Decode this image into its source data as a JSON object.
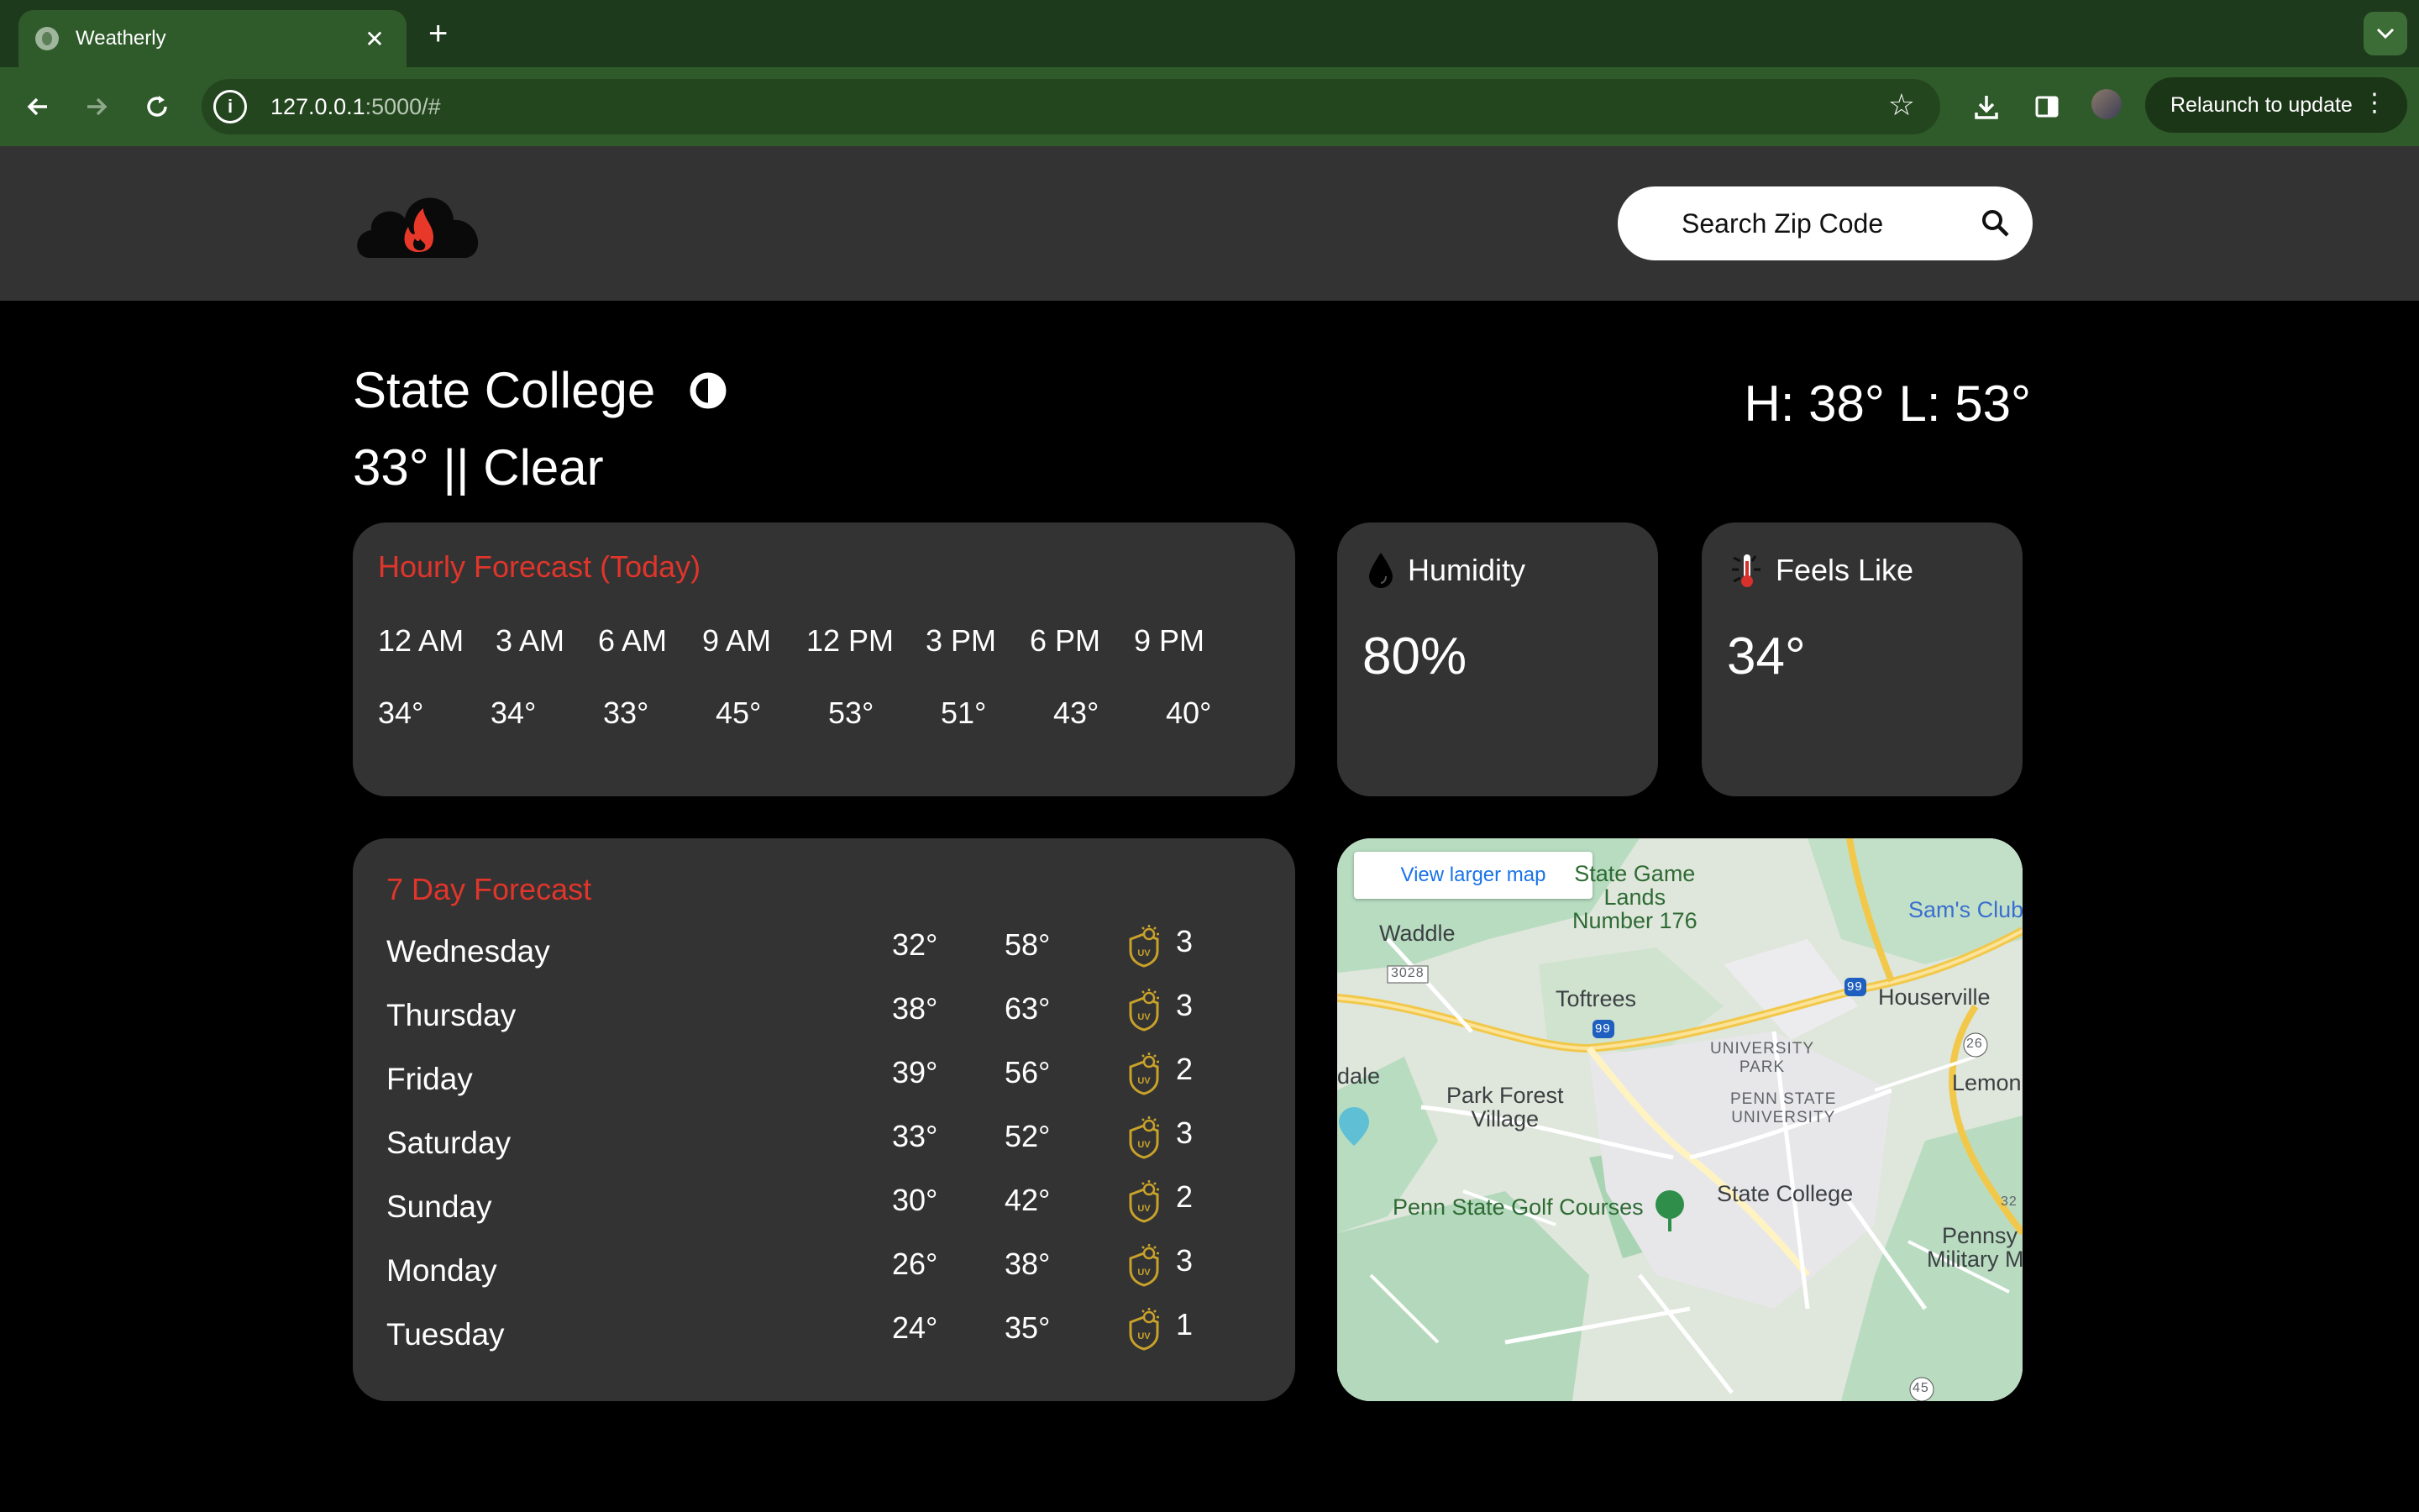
{
  "browser": {
    "tab_title": "Weatherly",
    "tab_close": "✕",
    "new_tab": "+",
    "url_host": "127.0.0.1",
    "url_rest": ":5000/#",
    "relaunch_label": "Relaunch to update"
  },
  "header": {
    "search_placeholder": "Search Zip Code"
  },
  "current": {
    "city": "State College",
    "summary": "33° || Clear",
    "hilo": "H: 38°  L: 53°"
  },
  "hourly": {
    "title": "Hourly Forecast (Today)",
    "hours": [
      "12 AM",
      "3 AM",
      "6 AM",
      "9 AM",
      "12 PM",
      "3 PM",
      "6 PM",
      "9 PM"
    ],
    "temps": [
      "34°",
      "34°",
      "33°",
      "45°",
      "53°",
      "51°",
      "43°",
      "40°"
    ]
  },
  "humidity": {
    "label": "Humidity",
    "value": "80%"
  },
  "feels_like": {
    "label": "Feels Like",
    "value": "34°"
  },
  "weekly": {
    "title": "7 Day Forecast",
    "days": [
      {
        "name": "Wednesday",
        "lo": "32°",
        "hi": "58°",
        "uv": "3"
      },
      {
        "name": "Thursday",
        "lo": "38°",
        "hi": "63°",
        "uv": "3"
      },
      {
        "name": "Friday",
        "lo": "39°",
        "hi": "56°",
        "uv": "2"
      },
      {
        "name": "Saturday",
        "lo": "33°",
        "hi": "52°",
        "uv": "3"
      },
      {
        "name": "Sunday",
        "lo": "30°",
        "hi": "42°",
        "uv": "2"
      },
      {
        "name": "Monday",
        "lo": "26°",
        "hi": "38°",
        "uv": "3"
      },
      {
        "name": "Tuesday",
        "lo": "24°",
        "hi": "35°",
        "uv": "1"
      }
    ]
  },
  "map": {
    "view_larger": "View larger map",
    "labels": {
      "state_game_lands": "State Game\nLands\nNumber 176",
      "sams_club": "Sam's Club",
      "waddle": "Waddle",
      "route_3028": "3028",
      "toftrees": "Toftrees",
      "houserville": "Houserville",
      "route_99a": "99",
      "route_99b": "99",
      "route_26": "26",
      "university_park": "UNIVERSITY\nPARK",
      "penn_state_university": "PENN STATE\nUNIVERSITY",
      "lemont": "Lemon",
      "dale": "dale",
      "park_forest_village": "Park Forest\nVillage",
      "penn_state_golf": "Penn State Golf Courses",
      "state_college": "State College",
      "pennsy": "Pennsy",
      "military": "Military Mu",
      "route_45": "45",
      "route_32": "32"
    }
  },
  "colors": {
    "accent_red": "#e0352b",
    "card_bg": "#333333",
    "header_bg": "#333333",
    "uv_gold": "#c9a22a"
  }
}
